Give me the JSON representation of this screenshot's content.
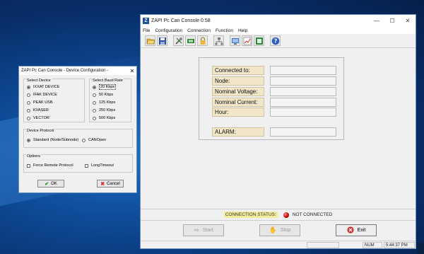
{
  "main_window": {
    "title": "ZAPI Pc Can Console 0.58",
    "icon_letter": "Z",
    "controls": {
      "minimize": "—",
      "maximize": "☐",
      "close": "✕"
    },
    "menu": [
      "File",
      "Configuration",
      "Connection",
      "Function",
      "Help"
    ],
    "toolbar": [
      "open-icon",
      "save-icon",
      "tools-icon",
      "chip-icon",
      "lock-icon",
      "network-icon",
      "monitor-icon",
      "chart-icon",
      "export-icon",
      "help-icon"
    ],
    "info_panel": {
      "rows": [
        {
          "label": "Connected to:",
          "value": ""
        },
        {
          "label": "Node:",
          "value": ""
        },
        {
          "label": "Nominal Voltage:",
          "value": ""
        },
        {
          "label": "Nominal Current:",
          "value": ""
        },
        {
          "label": "Hour:",
          "value": ""
        }
      ],
      "alarm": {
        "label": "ALARM:",
        "value": ""
      }
    },
    "connection": {
      "label": "CONNECTION STATUS:",
      "value": "NOT CONNECTED",
      "led_color": "#c40000"
    },
    "buttons": {
      "start": "Start",
      "stop": "Stop",
      "exit": "Exit"
    },
    "status_bar": {
      "num": "NUM",
      "time": "5:44:37 PM"
    }
  },
  "dialog": {
    "title": "ZAPI Pc Can Console - Device Configuration -",
    "close": "✕",
    "select_device": {
      "label": "Select Device",
      "options": [
        "IXXAT DEVICE",
        "IFAK DEVICE",
        "PEAK USB",
        "KVASER",
        "VECTOR"
      ],
      "selected": 0
    },
    "select_baud": {
      "label": "Select Baud Rate",
      "options": [
        "20 Kbps",
        "50 Kbps",
        "125 Kbps",
        "250 Kbps",
        "500 Kbps"
      ],
      "selected": 0
    },
    "protocol": {
      "label": "Device Protocol",
      "options": [
        "Standard (Node/Subnode)",
        "CANOpen"
      ],
      "selected": 0
    },
    "options": {
      "label": "Options",
      "items": [
        "Force Remote Protocol",
        "LongTimeout"
      ]
    },
    "ok_label": "OK",
    "cancel_label": "Cancel"
  }
}
